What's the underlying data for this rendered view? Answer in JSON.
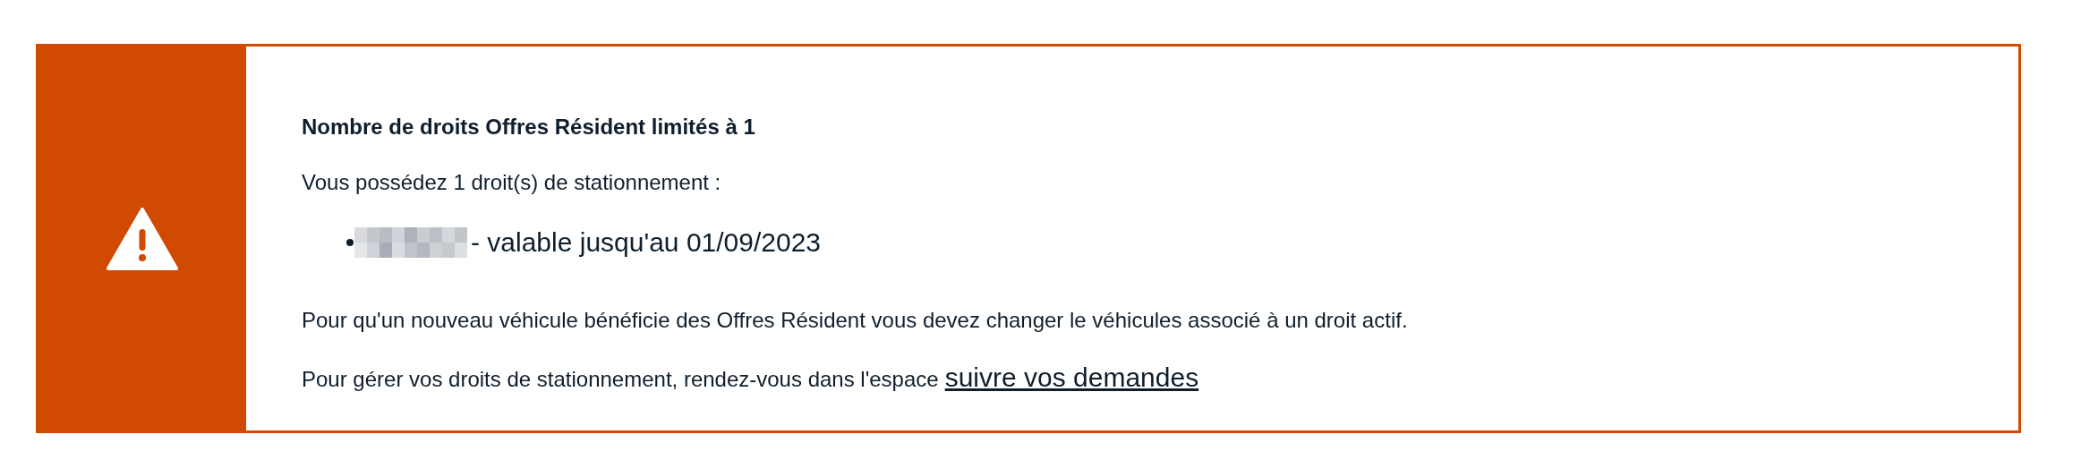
{
  "alert": {
    "title": "Nombre de droits Offres Résident limités à 1",
    "intro": "Vous possédez 1 droit(s) de stationnement :",
    "rights": [
      {
        "validity": "- valable jusqu'au 01/09/2023"
      }
    ],
    "message": "Pour qu'un nouveau véhicule bénéficie des Offres Résident vous devez changer le véhicules associé à un droit actif.",
    "manage_text": "Pour gérer vos droits de stationnement, rendez-vous dans l'espace",
    "manage_link": "suivre vos demandes"
  }
}
